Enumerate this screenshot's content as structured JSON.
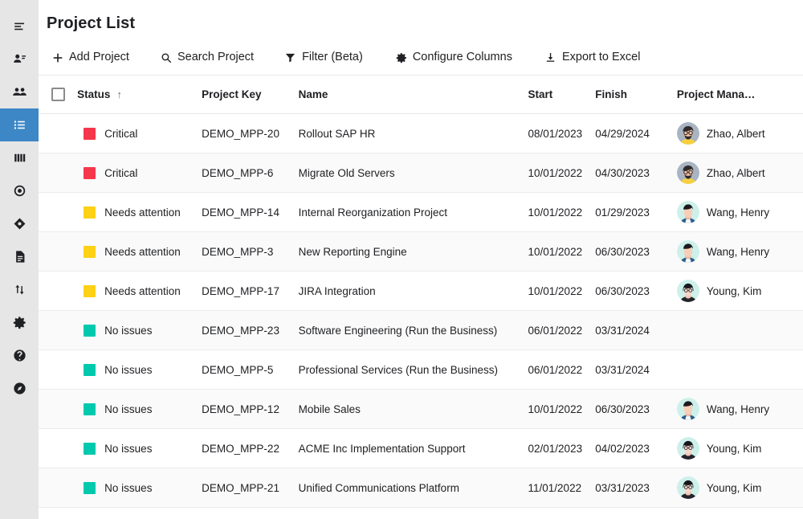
{
  "sidebar": {
    "items": [
      {
        "name": "menu-collapse-icon",
        "icon": "lines-align"
      },
      {
        "name": "user-details-icon",
        "icon": "person-lines"
      },
      {
        "name": "people-group-icon",
        "icon": "people"
      },
      {
        "name": "project-list-icon",
        "icon": "list",
        "active": true
      },
      {
        "name": "columns-board-icon",
        "icon": "columns"
      },
      {
        "name": "target-icon",
        "icon": "target"
      },
      {
        "name": "diamond-icon",
        "icon": "diamond"
      },
      {
        "name": "document-icon",
        "icon": "document"
      },
      {
        "name": "sort-updown-icon",
        "icon": "updown"
      },
      {
        "name": "settings-gear-icon",
        "icon": "gear"
      },
      {
        "name": "help-circle-icon",
        "icon": "help"
      },
      {
        "name": "compass-icon",
        "icon": "compass"
      }
    ],
    "active_color": "#3d87c6",
    "background": "#e6e6e6"
  },
  "header": {
    "title": "Project List"
  },
  "toolbar": {
    "buttons": [
      {
        "label": "Add Project",
        "icon": "plus-icon"
      },
      {
        "label": "Search Project",
        "icon": "search-icon"
      },
      {
        "label": "Filter (Beta)",
        "icon": "filter-icon"
      },
      {
        "label": "Configure Columns",
        "icon": "gear-icon"
      },
      {
        "label": "Export to Excel",
        "icon": "download-icon"
      }
    ]
  },
  "table": {
    "select_all_checked": false,
    "sort_column": "Status",
    "sort_direction": "ascending",
    "sort_arrow": "↑",
    "columns": [
      {
        "key": "status",
        "label": "Status"
      },
      {
        "key": "project_key",
        "label": "Project Key"
      },
      {
        "key": "name",
        "label": "Name"
      },
      {
        "key": "start",
        "label": "Start"
      },
      {
        "key": "finish",
        "label": "Finish"
      },
      {
        "key": "manager",
        "label": "Project Mana…"
      }
    ],
    "status_colors": {
      "Critical": "#f5364b",
      "Needs attention": "#fcd116",
      "No issues": "#00c9ae"
    },
    "rows": [
      {
        "status": "Critical",
        "project_key": "DEMO_MPP-20",
        "name": "Rollout SAP HR",
        "start": "08/01/2023",
        "finish": "04/29/2024",
        "manager": "Zhao, Albert",
        "avatar": "albert"
      },
      {
        "status": "Critical",
        "project_key": "DEMO_MPP-6",
        "name": "Migrate Old Servers",
        "start": "10/01/2022",
        "finish": "04/30/2023",
        "manager": "Zhao, Albert",
        "avatar": "albert"
      },
      {
        "status": "Needs attention",
        "project_key": "DEMO_MPP-14",
        "name": "Internal Reorganization Project",
        "start": "10/01/2022",
        "finish": "01/29/2023",
        "manager": "Wang, Henry",
        "avatar": "henry"
      },
      {
        "status": "Needs attention",
        "project_key": "DEMO_MPP-3",
        "name": "New Reporting Engine",
        "start": "10/01/2022",
        "finish": "06/30/2023",
        "manager": "Wang, Henry",
        "avatar": "henry"
      },
      {
        "status": "Needs attention",
        "project_key": "DEMO_MPP-17",
        "name": "JIRA Integration",
        "start": "10/01/2022",
        "finish": "06/30/2023",
        "manager": "Young, Kim",
        "avatar": "kim"
      },
      {
        "status": "No issues",
        "project_key": "DEMO_MPP-23",
        "name": "Software Engineering (Run the Business)",
        "start": "06/01/2022",
        "finish": "03/31/2024",
        "manager": "",
        "avatar": ""
      },
      {
        "status": "No issues",
        "project_key": "DEMO_MPP-5",
        "name": "Professional Services (Run the Business)",
        "start": "06/01/2022",
        "finish": "03/31/2024",
        "manager": "",
        "avatar": ""
      },
      {
        "status": "No issues",
        "project_key": "DEMO_MPP-12",
        "name": "Mobile Sales",
        "start": "10/01/2022",
        "finish": "06/30/2023",
        "manager": "Wang, Henry",
        "avatar": "henry"
      },
      {
        "status": "No issues",
        "project_key": "DEMO_MPP-22",
        "name": "ACME Inc Implementation Support",
        "start": "02/01/2023",
        "finish": "04/02/2023",
        "manager": "Young, Kim",
        "avatar": "kim"
      },
      {
        "status": "No issues",
        "project_key": "DEMO_MPP-21",
        "name": "Unified Communications Platform",
        "start": "11/01/2022",
        "finish": "03/31/2023",
        "manager": "Young, Kim",
        "avatar": "kim"
      }
    ]
  }
}
